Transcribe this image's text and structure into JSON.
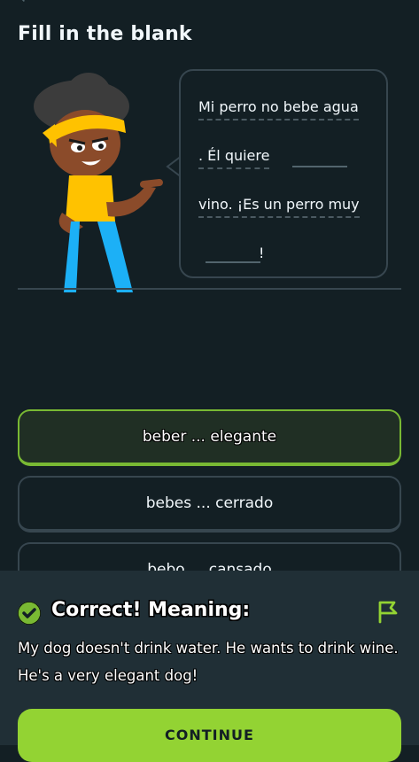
{
  "header": {
    "title": "Fill in the blank",
    "back_icon": "back-arrow-icon"
  },
  "exercise": {
    "lines": [
      {
        "text": "Mi perro no bebe agua",
        "blank_after": false
      },
      {
        "text": ". Él quiere",
        "blank_after": true
      },
      {
        "text": "vino. ¡Es un perro muy",
        "blank_after": false
      },
      {
        "text": "!",
        "blank_after": false
      }
    ]
  },
  "options": [
    {
      "label": "beber ... elegante",
      "selected": true
    },
    {
      "label": "bebes ... cerrado",
      "selected": false
    },
    {
      "label": "bebo ... cansado",
      "selected": false
    }
  ],
  "feedback": {
    "title": "Correct! Meaning:",
    "meaning": "My dog doesn't drink water. He wants to drink wine. He's a very elegant dog!",
    "continue_label": "CONTINUE",
    "icons": [
      "check-circle-icon",
      "report-flag-icon"
    ]
  },
  "colors": {
    "background": "#131f24",
    "border": "#37464f",
    "accent_green": "#93d333",
    "selected_border": "#79b933",
    "feedback_bg": "#202f36"
  }
}
